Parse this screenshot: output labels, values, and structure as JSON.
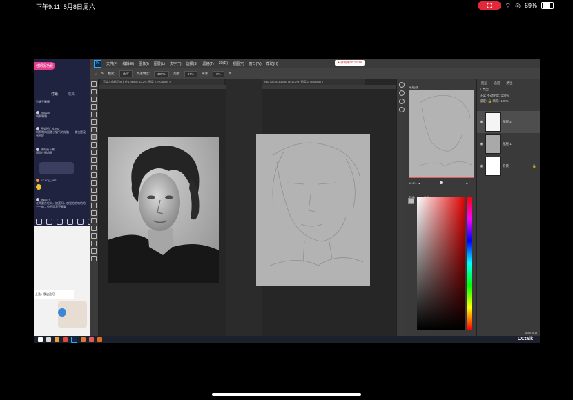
{
  "status_bar": {
    "time": "下午9:11",
    "date": "5月8日周六",
    "battery": "69%",
    "battery_level": 0.69
  },
  "chat": {
    "title": "佳期捉功颖",
    "tabs": [
      "讨论",
      "成员"
    ],
    "messages": [
      {
        "user": "",
        "text": "见缝子删掉"
      },
      {
        "user": "Nouvah",
        "text": "啊啊啊啊"
      },
      {
        "user": "困如视广欢y96",
        "text": "啊啊啊的图是小猫气的电脑一一就也是没有不好"
      },
      {
        "user": "清阿敲下来",
        "text": "啊是在画吗啊"
      },
      {
        "user": "KCAC(I_082",
        "text": ""
      },
      {
        "user": "msc679",
        "text": "老师要在吃么，加速吗，感觉哈哈哈哈哈一一的，也不是我不需要"
      }
    ],
    "subtitle": "上法，我这这可一"
  },
  "photoshop": {
    "menu": [
      "文件(F)",
      "编辑(E)",
      "图像(I)",
      "图层(L)",
      "文字(Y)",
      "选择(S)",
      "滤镜(T)",
      "3D(D)",
      "视图(V)",
      "窗口(W)",
      "帮助(H)"
    ],
    "recording_badge": "● 录制中00:12:28",
    "options": {
      "mode_label": "模式:",
      "mode": "正常",
      "opacity_label": "不透明度:",
      "opacity": "100%",
      "flow_label": "流量:",
      "flow": "67%",
      "smoothing_label": "平滑:",
      "smoothing": "0%"
    },
    "docs": [
      {
        "title": "写实人像练习@文件1.psd @ 12.2% (图层 2, RGB/8#) ×"
      },
      {
        "title": "N6270018183.psd @ 12.2% (图层 2, RGB/8#) ×"
      }
    ],
    "navigator": {
      "tabs": [
        "导航器"
      ],
      "zoom": "12.2%"
    },
    "color_panel": {
      "tabs": [
        "颜色",
        "色板"
      ],
      "hue_color": "#e00000"
    },
    "layers": {
      "tabs": [
        "图层",
        "通道",
        "路径"
      ],
      "kind_label": "类型",
      "blend_mode": "正常",
      "opacity_label": "不透明度:",
      "opacity": "100%",
      "lock_label": "锁定:",
      "fill_label": "填充:",
      "fill": "100%",
      "items": [
        {
          "name": "图层 2",
          "visible": true
        },
        {
          "name": "图层 1",
          "visible": true
        },
        {
          "name": "背景",
          "visible": true
        }
      ]
    }
  },
  "taskbar": {
    "brand": "CCtalk",
    "date": "2020/10/18"
  }
}
